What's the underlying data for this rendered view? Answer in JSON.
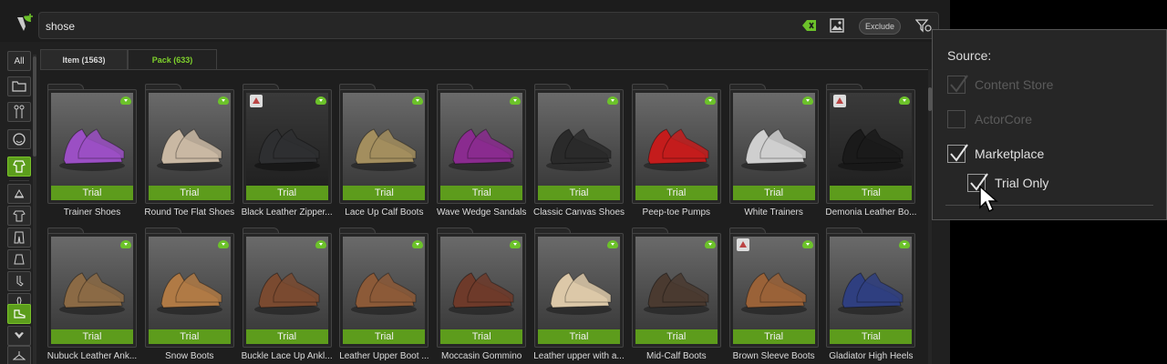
{
  "search": {
    "value": "shose"
  },
  "toolbar": {
    "exclude_label": "Exclude"
  },
  "left_nav": {
    "all_label": "All"
  },
  "tabs": [
    {
      "label": "Item (1563)",
      "active": false
    },
    {
      "label": "Pack (633)",
      "active": true
    }
  ],
  "badge_label": "Trial",
  "accent_color": "#5d9c1c",
  "items_row1": [
    {
      "name": "Trainer Shoes",
      "shoe_color": "#9b4fc4",
      "vendor": false
    },
    {
      "name": "Round Toe Flat Shoes",
      "shoe_color": "#c9b8a3",
      "vendor": false
    },
    {
      "name": "Black Leather Zipper...",
      "shoe_color": "#2e2f31",
      "vendor": true
    },
    {
      "name": "Lace Up Calf Boots",
      "shoe_color": "#a38e5e",
      "vendor": false
    },
    {
      "name": "Wave Wedge Sandals",
      "shoe_color": "#8a2b8f",
      "vendor": false
    },
    {
      "name": "Classic Canvas Shoes",
      "shoe_color": "#2a2a2a",
      "vendor": false
    },
    {
      "name": "Peep-toe Pumps",
      "shoe_color": "#c41c1c",
      "vendor": false
    },
    {
      "name": "White Trainers",
      "shoe_color": "#cfcfcf",
      "vendor": false
    },
    {
      "name": "Demonia Leather Bo...",
      "shoe_color": "#1a1a1a",
      "vendor": true
    }
  ],
  "items_row2": [
    {
      "name": "Nubuck Leather Ank...",
      "shoe_color": "#8b6a45",
      "vendor": false
    },
    {
      "name": "Snow Boots",
      "shoe_color": "#b07a45",
      "vendor": false
    },
    {
      "name": "Buckle Lace Up Ankl...",
      "shoe_color": "#7a4a30",
      "vendor": false
    },
    {
      "name": "Leather Upper Boot ...",
      "shoe_color": "#8c5a38",
      "vendor": false
    },
    {
      "name": "Moccasin Gommino",
      "shoe_color": "#6e3a2a",
      "vendor": false
    },
    {
      "name": "Leather upper with a...",
      "shoe_color": "#dcc8a8",
      "vendor": false
    },
    {
      "name": "Mid-Calf Boots",
      "shoe_color": "#4a3a30",
      "vendor": false
    },
    {
      "name": "Brown Sleeve Boots",
      "shoe_color": "#9a6238",
      "vendor": true
    },
    {
      "name": "Gladiator High Heels",
      "shoe_color": "#2f3f80",
      "vendor": false
    }
  ],
  "filter_popup": {
    "title": "Source:",
    "options": [
      {
        "label": "Content Store",
        "checked": true,
        "enabled": false
      },
      {
        "label": "ActorCore",
        "checked": false,
        "enabled": false
      },
      {
        "label": "Marketplace",
        "checked": true,
        "enabled": true
      },
      {
        "label": "Trial Only",
        "checked": true,
        "enabled": true
      }
    ]
  }
}
